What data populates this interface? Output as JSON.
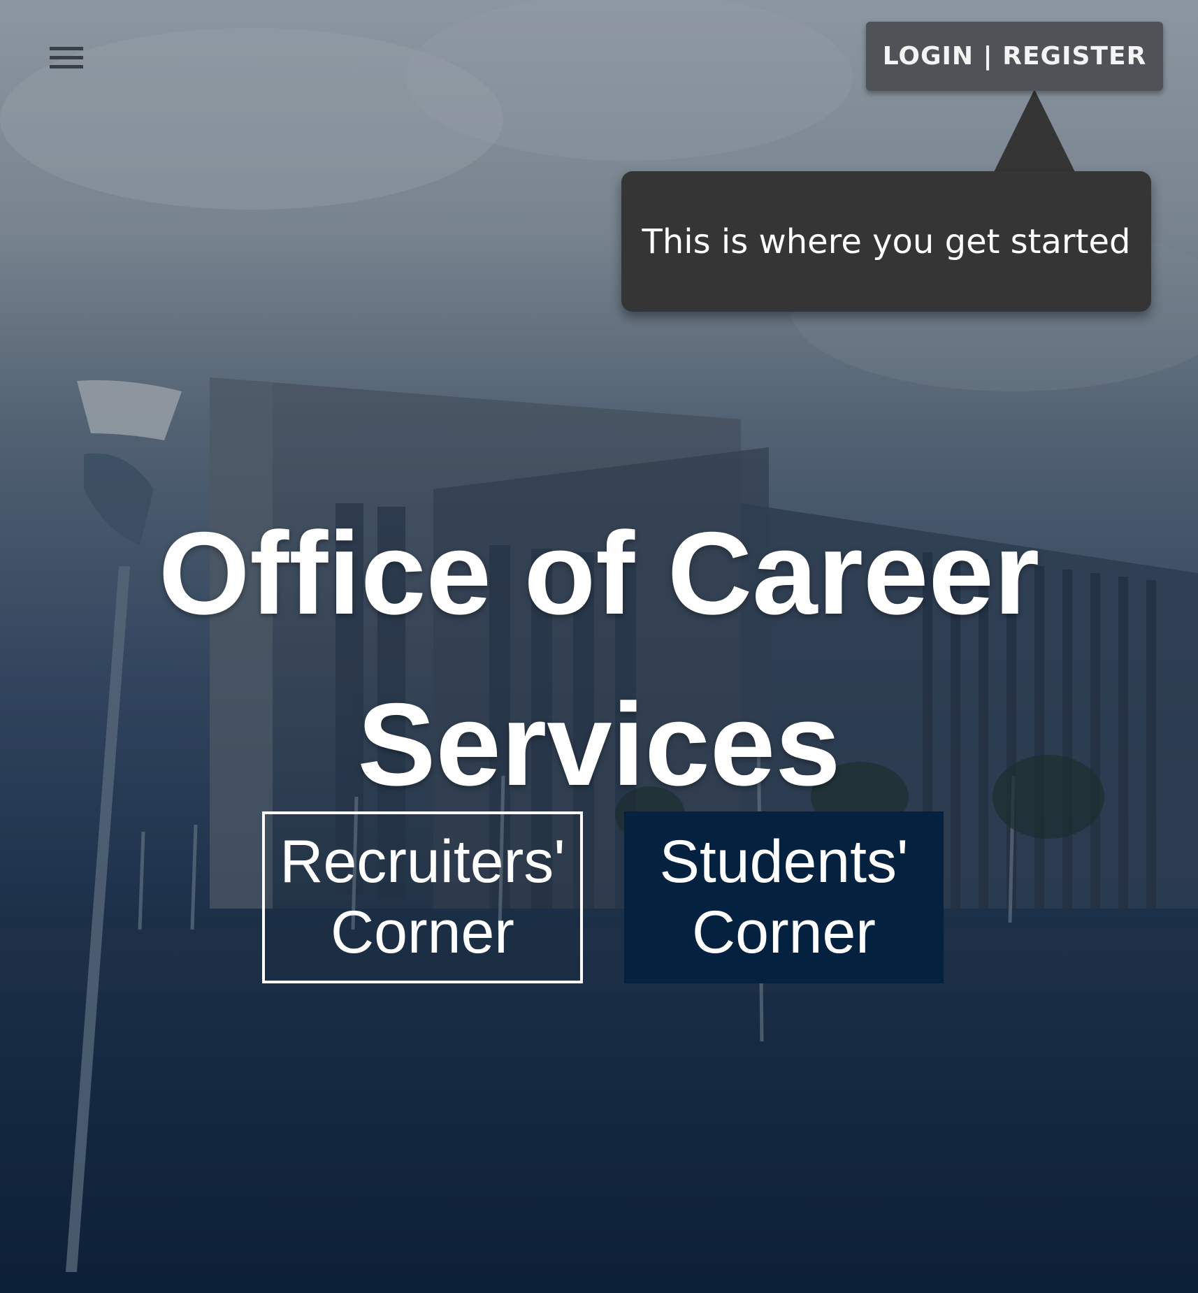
{
  "header": {
    "menu_icon": "hamburger-menu-icon",
    "login_label": "LOGIN | REGISTER"
  },
  "tooltip": {
    "text": "This is where you get started"
  },
  "hero": {
    "title_line1": "Office of Career",
    "title_line2": "Services"
  },
  "buttons": {
    "recruiters_line1": "Recruiters'",
    "recruiters_line2": "Corner",
    "students_line1": "Students'",
    "students_line2": "Corner"
  },
  "colors": {
    "students_button_bg": "#04223f",
    "tooltip_bg": "#353535",
    "login_button_bg": "#4f5256",
    "text": "#ffffff"
  }
}
